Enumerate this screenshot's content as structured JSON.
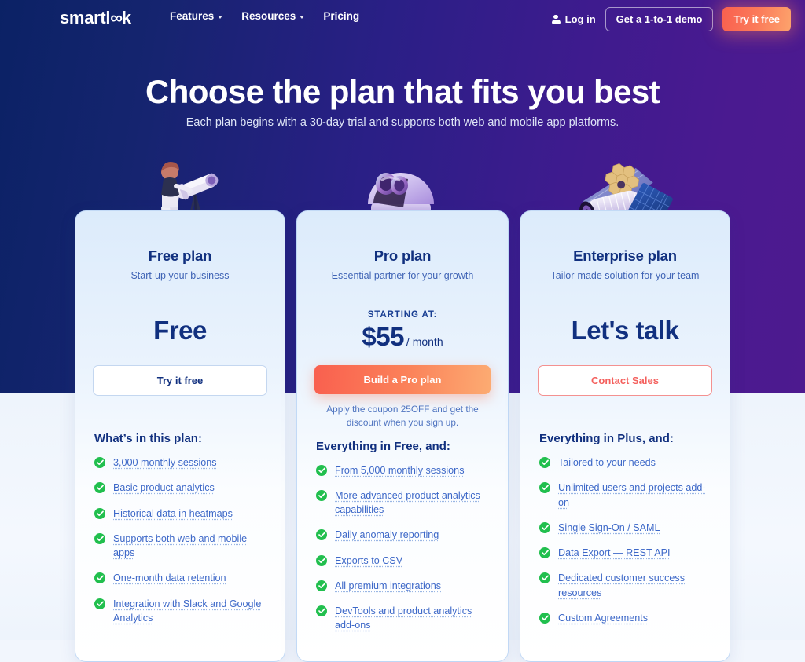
{
  "brand": {
    "logo_text_left": "smartl",
    "logo_infinity": "∞",
    "logo_text_right": "k",
    "accent_orange": "#fb7a5a",
    "accent_navy": "#11307f",
    "accent_green": "#21bf4e",
    "accent_red": "#f4605d"
  },
  "nav": {
    "links": [
      {
        "label": "Features",
        "has_caret": true
      },
      {
        "label": "Resources",
        "has_caret": true
      },
      {
        "label": "Pricing",
        "has_caret": false
      }
    ],
    "login_label": "Log in",
    "demo_label": "Get a 1-to-1 demo",
    "try_label": "Try it free"
  },
  "hero": {
    "title": "Choose the plan that fits you best",
    "subtitle": "Each plan begins with a 30-day trial and supports both web and mobile app platforms."
  },
  "plans": [
    {
      "id": "free",
      "illustration": "astronomer-telescope-illustration",
      "title": "Free plan",
      "subtitle": "Start-up your business",
      "price_label": "Free",
      "starting_at": "",
      "price_amount": "",
      "price_period": "",
      "cta_label": "Try it free",
      "cta_style": "outline-blue",
      "coupon_note": "",
      "features_title_prefix": "What’s in this plan:",
      "features_title_bold": "",
      "features_title_suffix": "",
      "features": [
        {
          "text": "3,000 monthly sessions",
          "linked": true
        },
        {
          "text": "Basic product analytics",
          "linked": true
        },
        {
          "text": "Historical data in heatmaps",
          "linked": true
        },
        {
          "text": "Supports both web and mobile apps",
          "linked": true
        },
        {
          "text": "One-month data retention",
          "linked": true
        },
        {
          "text": "Integration with Slack and Google Analytics",
          "linked": true
        }
      ]
    },
    {
      "id": "pro",
      "illustration": "observatory-dome-illustration",
      "title": "Pro plan",
      "subtitle": "Essential partner for your growth",
      "price_label": "",
      "starting_at": "STARTING AT:",
      "price_amount": "$55",
      "price_period": "/ month",
      "cta_label": "Build a Pro plan",
      "cta_style": "gradient",
      "coupon_note": "Apply the coupon 25OFF and get the discount when you sign up.",
      "features_title_prefix": "Everything in ",
      "features_title_bold": "Free",
      "features_title_suffix": ", and:",
      "features": [
        {
          "text": "From 5,000 monthly sessions",
          "linked": true
        },
        {
          "text": "More advanced product analytics capabilities",
          "linked": true
        },
        {
          "text": "Daily anomaly reporting",
          "linked": true
        },
        {
          "text": "Exports to CSV",
          "linked": true
        },
        {
          "text": "All premium integrations",
          "linked": true
        },
        {
          "text": "DevTools and product analytics add-ons",
          "linked": true
        }
      ]
    },
    {
      "id": "enterprise",
      "illustration": "space-telescope-satellite-illustration",
      "title": "Enterprise plan",
      "subtitle": "Tailor-made solution for your team",
      "price_label": "Let's talk",
      "starting_at": "",
      "price_amount": "",
      "price_period": "",
      "cta_label": "Contact Sales",
      "cta_style": "outline-red",
      "coupon_note": "",
      "features_title_prefix": "Everything in ",
      "features_title_bold": "Plus",
      "features_title_suffix": ", and:",
      "features": [
        {
          "text": "Tailored to your needs",
          "linked": false
        },
        {
          "text": "Unlimited users and projects add-on",
          "linked": true
        },
        {
          "text": "Single Sign-On / SAML",
          "linked": true
        },
        {
          "text": "Data Export — REST API",
          "linked": true
        },
        {
          "text": "Dedicated customer success resources",
          "linked": true
        },
        {
          "text": "Custom Agreements",
          "linked": true
        }
      ]
    }
  ]
}
